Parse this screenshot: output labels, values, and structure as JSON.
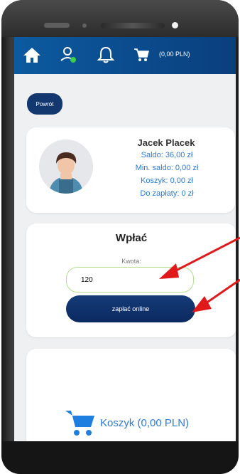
{
  "header": {
    "cart_amount": "(0,00 PLN)"
  },
  "back_button": "Powrót",
  "profile": {
    "name": "Jacek Placek",
    "balance": "Saldo: 36,00 zł",
    "min_balance": "Min. saldo: 0,00 zł",
    "cart": "Koszyk: 0,00 zł",
    "to_pay": "Do zapłaty: 0 zł"
  },
  "topup": {
    "title": "Wpłać",
    "amount_label": "Kwota:",
    "amount_value": "120",
    "pay_button": "zapłać online"
  },
  "cart_section": {
    "label": "Koszyk (0,00 PLN)"
  },
  "colors": {
    "header": "#0c5aa0",
    "accent": "#2b7bd8",
    "button": "#13386f",
    "annotation_arrow": "#e0191b"
  }
}
